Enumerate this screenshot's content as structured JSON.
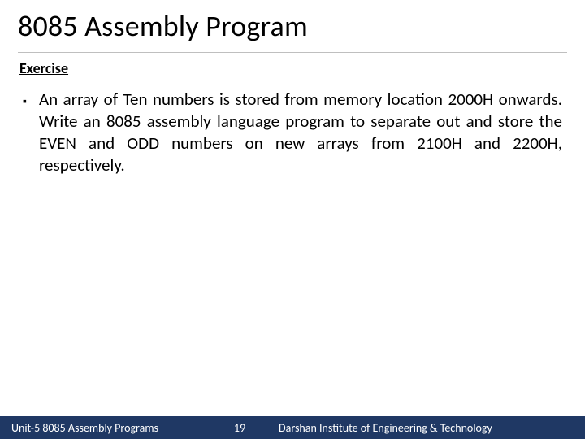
{
  "title": "8085 Assembly Program",
  "subtitle": "Exercise",
  "bullets": [
    {
      "text": "An array of Ten numbers is stored from memory location 2000H onwards. Write an 8085 assembly language program to separate out and store the EVEN and ODD numbers on new arrays from 2100H and 2200H, respectively."
    }
  ],
  "footer": {
    "left": "Unit-5 8085 Assembly Programs",
    "page": "19",
    "right": "Darshan Institute of Engineering & Technology"
  },
  "colors": {
    "footer_bg": "#1f3864",
    "rule": "#bfbfbf"
  }
}
